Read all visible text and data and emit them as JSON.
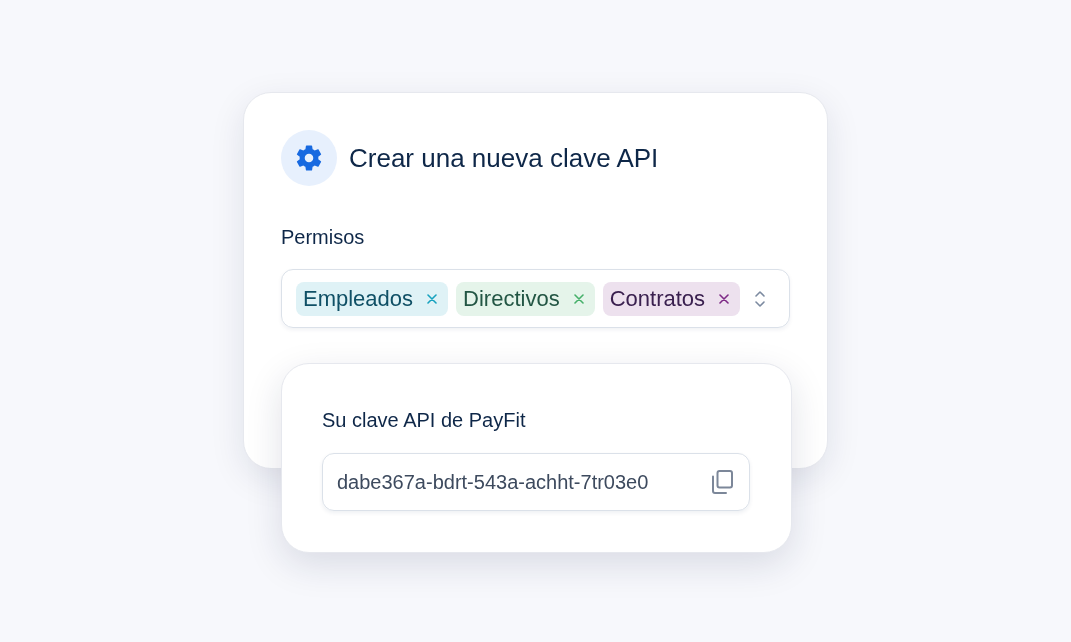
{
  "dialog": {
    "title": "Crear una nueva clave API",
    "permissions": {
      "label": "Permisos",
      "tags": [
        {
          "label": "Empleados",
          "color": "#17a2bf"
        },
        {
          "label": "Directivos",
          "color": "#46b06a"
        },
        {
          "label": "Contratos",
          "color": "#7e2a86"
        }
      ]
    }
  },
  "api_key": {
    "label": "Su clave API de PayFit",
    "value": "dabe367a-bdrt-543a-achht-7tr03e0"
  }
}
